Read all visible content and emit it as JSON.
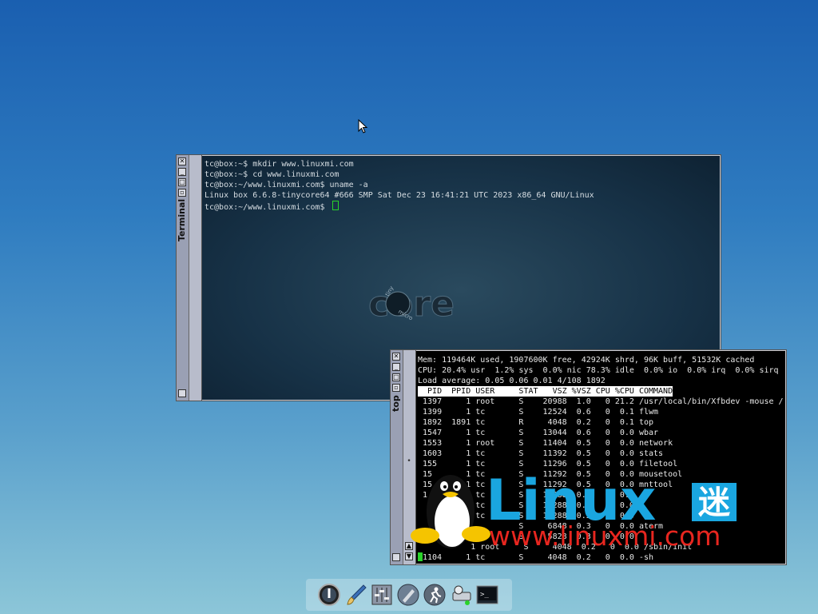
{
  "terminal": {
    "title": "Terminal",
    "lines": [
      "tc@box:~$ mkdir www.linuxmi.com",
      "tc@box:~$ cd www.linuxmi.com",
      "tc@box:~/www.linuxmi.com$ uname -a",
      "Linux box 6.6.8-tinycore64 #666 SMP Sat Dec 23 16:41:21 UTC 2023 x86_64 GNU/Linux",
      "tc@box:~/www.linuxmi.com$ "
    ],
    "logo": {
      "word": "core",
      "small_top": "tiny",
      "small_bottom": "micro"
    }
  },
  "top": {
    "title": "top",
    "summary": [
      "Mem: 119464K used, 1907600K free, 42924K shrd, 96K buff, 51532K cached",
      "CPU: 20.4% usr  1.2% sys  0.0% nic 78.3% idle  0.0% io  0.0% irq  0.0% sirq",
      "Load average: 0.05 0.06 0.01 4/108 1892"
    ],
    "header": "  PID  PPID USER     STAT   VSZ %VSZ CPU %CPU COMMAND",
    "rows": [
      " 1397     1 root     S    20988  1.0   0 21.2 /usr/local/bin/Xfbdev -mouse /",
      " 1399     1 tc       S    12524  0.6   0  0.1 flwm",
      " 1892  1891 tc       R     4048  0.2   0  0.1 top",
      " 1547     1 tc       S    13044  0.6   0  0.0 wbar",
      " 1553     1 root     S    11404  0.5   0  0.0 network",
      " 1603     1 tc       S    11392  0.5   0  0.0 stats",
      " 155      1 tc       S    11296  0.5   0  0.0 filetool",
      " 15       1 tc       S    11292  0.5   0  0.0 mousetool",
      " 15       1 tc       S    11292  0.5   0  0.0 mnttool",
      " 1        1 tc       S    11288  0.5   0  0.0 ",
      "          1 tc       S    11288  0.5   0  0.0 ",
      "            tc       S    11288  0.5   0  0.0 ",
      "                     S     6848  0.3   0  0.0 aterm",
      "                     S     5828  0.3   0  0.0 ",
      "           1 root     S     4048  0.2   0  0.0 /sbin/init"
    ],
    "last_row": "1104     1 tc       S     4048  0.2   0  0.0 -sh"
  },
  "watermark": {
    "brand": "Linux",
    "cn": "迷",
    "url": "www.linuxmi.com"
  },
  "dock": {
    "icons": [
      "power-icon",
      "paintbrush-icon",
      "control-panel-icon",
      "apps-icon",
      "run-icon",
      "mount-tool-icon",
      "terminal-icon"
    ]
  },
  "colors": {
    "terminal_bg": "#173247",
    "top_bg": "#000000",
    "cursor_green": "#2ad32a",
    "brand_blue": "#1aa6e0",
    "url_red": "#e8261f"
  }
}
